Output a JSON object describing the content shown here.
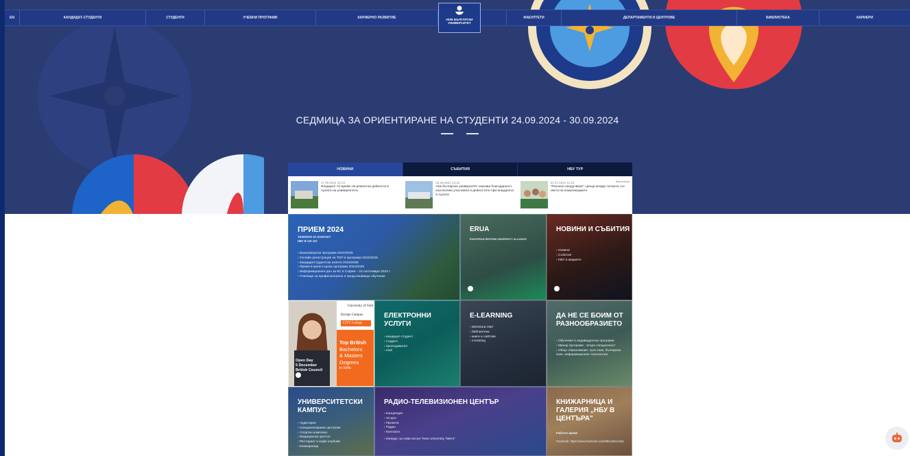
{
  "nav": {
    "items": [
      "EN",
      "Кандидат-студенти",
      "Студенти",
      "Учебни програми",
      "Кариерно развитие",
      "За НБУ",
      "Факултети",
      "Департаменти и центрове",
      "Библиотека",
      "Кариери"
    ],
    "logo_line1": "НОВ БЪЛГАРСКИ",
    "logo_line2": "УНИВЕРСИТЕТ"
  },
  "hero": {
    "title": "СЕДМИЦА ЗА ОРИЕНТИРАНЕ НА СТУДЕНТИ 24.09.2024 - 30.09.2024"
  },
  "tabs": [
    "НОВИНИ",
    "СЪБИТИЯ",
    "НБУ ТУР"
  ],
  "news": {
    "all_label": "Виж всички",
    "items": [
      {
        "date": "27.09.2024 10:13",
        "text": "Инцидент по време на ремонтни дейности в Аулата на университета"
      },
      {
        "date": "26.09.2024 14:25",
        "text": "Нов български университет изказва благодарност към всички участвали в дейностите при инцидента в Аулата"
      },
      {
        "date": "01.07.2024 11:18",
        "text": "\"Резонно неидучване\" среща млади таланти със света на комуникациите"
      }
    ]
  },
  "tiles": {
    "admission": {
      "title": "ПРИЕМ 2024",
      "sub1": "ТЕЛЕФОН ЗА КОНТАКТ",
      "sub2": "НБУ В 110 110",
      "items": [
        "Бакалавърски програми 2024/2025",
        "Онлайн регистрация за ТОП в програма 2024/2025",
        "Кандидатстудентски изпити 2024/2025",
        "Прием в магистърски програми 2024/2025",
        "Информационен ден за КС в София – 24 септември 2024 г.",
        "Училище за професионално и продължаващо обучение"
      ]
    },
    "erua": {
      "title": "ERUA",
      "sub": "EUROPEAN REFORM UNIVERSITY ALLIANCE"
    },
    "news_events": {
      "title": "НОВИНИ И СЪБИТИЯ",
      "items": [
        "Новини",
        "Събития",
        "НБУ в медиите"
      ]
    },
    "york": {
      "logo": "University of York",
      "campus": "Europe Campus",
      "college": "CITY College",
      "headline1": "Top British",
      "headline2": "Bachelors",
      "headline3": "& Masters",
      "headline4": "Degrees",
      "headline5": "in Sofia",
      "event1": "Open Day",
      "event2": "5 December",
      "event3": "British Council"
    },
    "eservices": {
      "title": "ЕЛЕКТРОННИ УСЛУГИ",
      "items": [
        "кандидат-студент",
        "студент",
        "преподавател",
        "mail"
      ]
    },
    "elearning": {
      "title": "E-LEARNING",
      "items": [
        "MOODLE НБУ",
        "библиотека",
        "книги и сайтове",
        "e-training"
      ]
    },
    "diversity": {
      "title": "ДА НЕ СЕ БОИМ ОТ РАЗНООБРАЗИЕТО",
      "items": [
        "Обучение в индивидуални програми",
        "Минор програми - втора специалност",
        "Общо образование: пуск език, български език, информационни технологии"
      ]
    },
    "campus": {
      "title": "УНИВЕРСИТЕТСКИ КАМПУС",
      "items": [
        "Аудитории",
        "Специализирани центрове",
        "Спортен комплекс",
        "Медицински центъп",
        "Ресторант и кафе клубове",
        "Книжарница"
      ]
    },
    "radio_tv": {
      "title": "РАДИО-ТЕЛЕВИЗИОНЕН ЦЕНТЪР",
      "items": [
        "Концепция",
        "Услуги",
        "Проекти",
        "Радио",
        "Контакти",
        "Конкурс за нови песни \"New University Talent\""
      ]
    },
    "bookstore": {
      "title": "КНИЖАРНИЦА И ГАЛЕРИЯ „НБУ В ЦЕНТЪРА\"",
      "sub": "Работно време",
      "fb": "Facebook: https://www.facebook.com/NBUartsCenter"
    }
  },
  "colors": {
    "navy": "#223a86",
    "hero": "#2b3c73",
    "accent_orange": "#f26a1f",
    "accent_yellow": "#f2b233",
    "accent_red": "#e23b43"
  }
}
